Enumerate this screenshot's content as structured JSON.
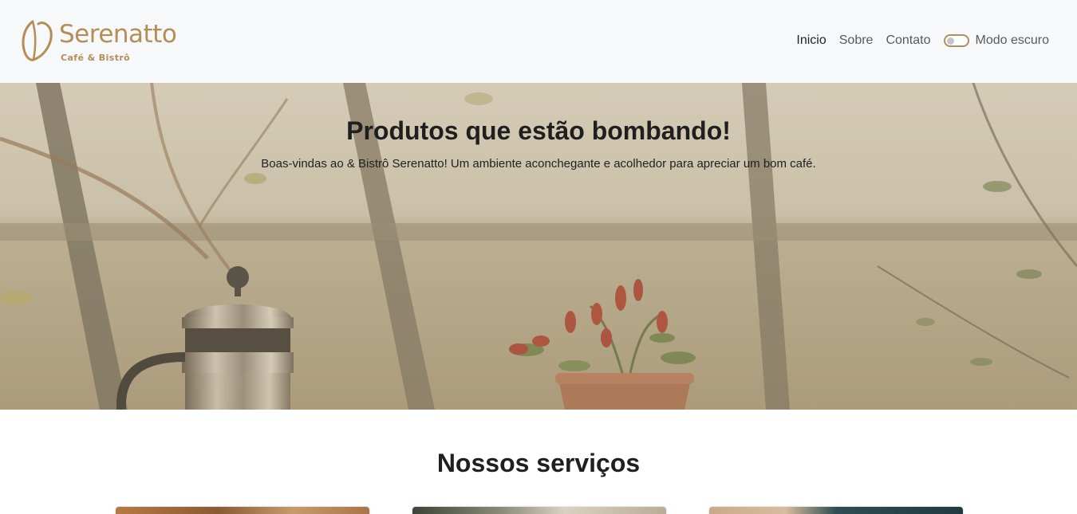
{
  "brand": {
    "name": "Serenatto",
    "subtitle": "Café & Bistrô",
    "color": "#b48e57"
  },
  "nav": {
    "items": [
      {
        "label": "Inicio",
        "active": true
      },
      {
        "label": "Sobre",
        "active": false
      },
      {
        "label": "Contato",
        "active": false
      }
    ],
    "dark_mode_label": "Modo escuro",
    "dark_mode_enabled": false
  },
  "hero": {
    "title": "Produtos que estão bombando!",
    "text": "Boas-vindas ao & Bistrô Serenatto! Um ambiente aconchegante e acolhedor para apreciar um bom café."
  },
  "services": {
    "title": "Nossos serviços",
    "cards": [
      {
        "name": "service-card-1"
      },
      {
        "name": "service-card-2"
      },
      {
        "name": "service-card-3"
      }
    ]
  }
}
